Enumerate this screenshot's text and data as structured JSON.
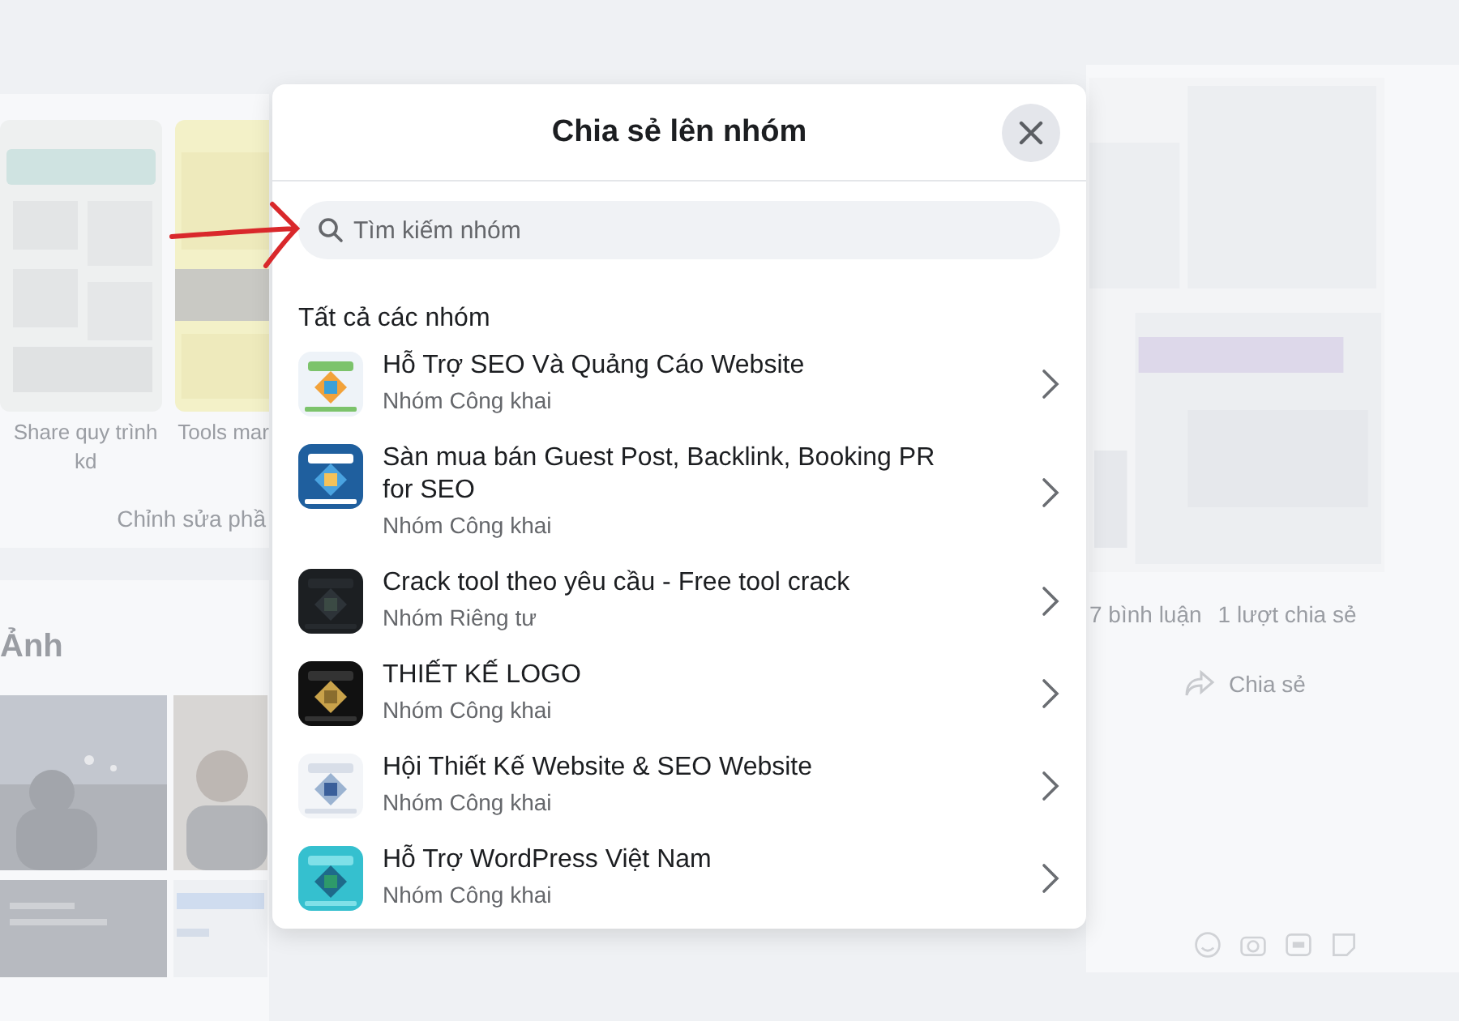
{
  "background": {
    "left": {
      "photo_captions": [
        "Share quy trình kd",
        "Tools mar"
      ],
      "edit_button": "Chỉnh sửa phầ",
      "photos_heading": "Ảnh"
    },
    "right": {
      "comments": "7 bình luận",
      "shares": "1 lượt chia sẻ",
      "share_button": "Chia sẻ"
    }
  },
  "dialog": {
    "title": "Chia sẻ lên nhóm",
    "search": {
      "placeholder": "Tìm kiếm nhóm"
    },
    "section_title": "Tất cả các nhóm",
    "groups": [
      {
        "name": "Hỗ Trợ SEO Và Quảng Cáo Website",
        "privacy": "Nhóm Công khai"
      },
      {
        "name": "Sàn mua bán Guest Post, Backlink, Booking PR for SEO",
        "privacy": "Nhóm Công khai"
      },
      {
        "name": "Crack tool theo yêu cầu - Free tool crack",
        "privacy": "Nhóm Riêng tư"
      },
      {
        "name": "THIẾT KẾ LOGO",
        "privacy": "Nhóm Công khai"
      },
      {
        "name": "Hội Thiết Kế Website & SEO Website",
        "privacy": "Nhóm Công khai"
      },
      {
        "name": "Hỗ Trợ WordPress Việt Nam",
        "privacy": "Nhóm Công khai"
      }
    ]
  }
}
